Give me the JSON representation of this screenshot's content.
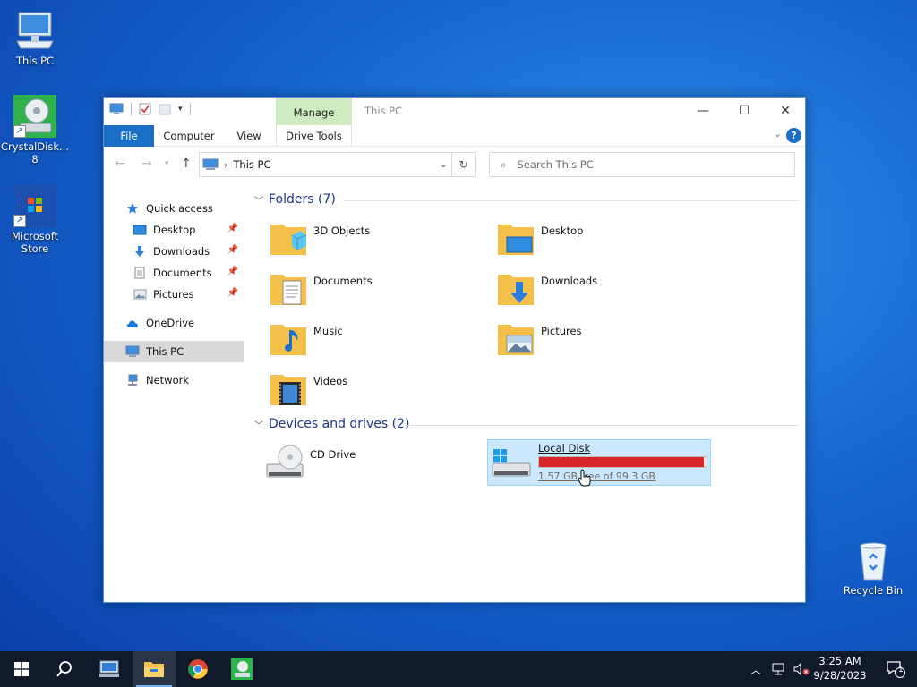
{
  "desktop": {
    "icons": [
      {
        "label": "This PC"
      },
      {
        "label": "CrystalDisk...\n8"
      },
      {
        "label": "Microsoft\nStore"
      },
      {
        "label": "Recycle Bin"
      }
    ]
  },
  "window": {
    "title": "This PC",
    "contextual_tab": "Manage",
    "ribbon_tabs": [
      "File",
      "Computer",
      "View",
      "Drive Tools"
    ],
    "address": {
      "crumb": "This PC"
    },
    "search": {
      "placeholder": "Search This PC"
    }
  },
  "nav": {
    "quick_access": "Quick access",
    "pinned": [
      "Desktop",
      "Downloads",
      "Documents",
      "Pictures"
    ],
    "onedrive": "OneDrive",
    "this_pc": "This PC",
    "network": "Network"
  },
  "content": {
    "folders_header": "Folders (7)",
    "folders": [
      "3D Objects",
      "Desktop",
      "Documents",
      "Downloads",
      "Music",
      "Pictures",
      "Videos"
    ],
    "drives_header": "Devices and drives (2)",
    "cd_drive": "CD Drive",
    "local_disk": {
      "label": "Local Disk",
      "free_text": "1.57 GB free of 99.3 GB",
      "used_fraction": 0.984
    }
  },
  "taskbar": {
    "time": "3:25 AM",
    "date": "9/28/2023",
    "notification_count": "1"
  },
  "colors": {
    "accent": "#1a70c7",
    "manage_tab": "#cdeac0",
    "selection": "#cce8ff",
    "drive_full": "#da2626"
  }
}
